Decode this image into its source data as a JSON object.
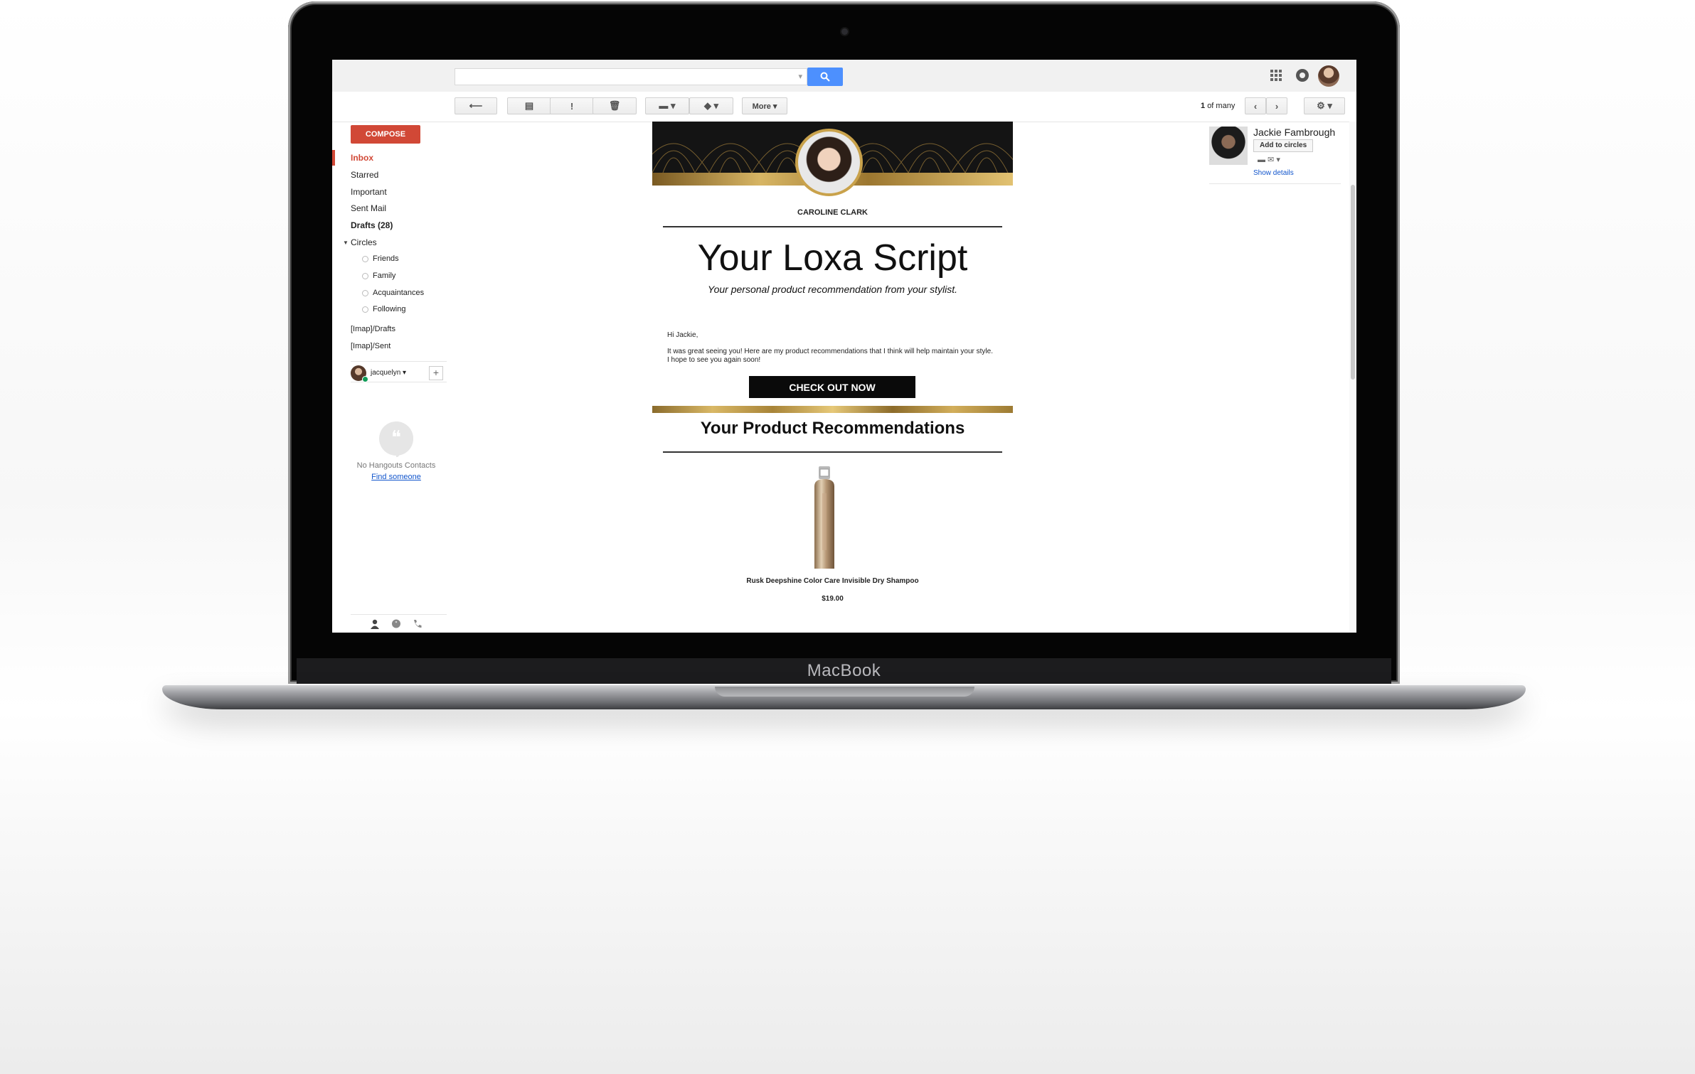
{
  "device": {
    "brand": "MacBook"
  },
  "search": {
    "placeholder": "",
    "caret": "▾"
  },
  "toolbar": {
    "back_glyph": "⟵",
    "archive_glyph": "▤",
    "spam_glyph": "!",
    "delete_glyph": "🗑",
    "folder_glyph": "▬ ▾",
    "label_glyph": "◆ ▾",
    "more_label": "More ▾",
    "pager_count": "1",
    "pager_of": "of many",
    "prev_glyph": "‹",
    "next_glyph": "›",
    "settings_glyph": "⚙ ▾"
  },
  "sidebar": {
    "compose_label": "COMPOSE",
    "items": [
      {
        "label": "Inbox"
      },
      {
        "label": "Starred"
      },
      {
        "label": "Important"
      },
      {
        "label": "Sent Mail"
      },
      {
        "label": "Drafts (28)"
      },
      {
        "label": "Circles"
      }
    ],
    "circles": [
      {
        "label": "Friends"
      },
      {
        "label": "Family"
      },
      {
        "label": "Acquaintances"
      },
      {
        "label": "Following"
      }
    ],
    "labels": [
      {
        "label": "[Imap]/Drafts"
      },
      {
        "label": "[Imap]/Sent"
      }
    ],
    "hangouts_user": "jacquelyn",
    "hangouts_user_caret": "▾",
    "hangouts_add": "+",
    "no_hangouts": "No Hangouts Contacts",
    "find_someone": "Find someone"
  },
  "email": {
    "stylist_name": "CAROLINE CLARK",
    "title": "Your Loxa Script",
    "subtitle": "Your personal product recommendation from your stylist.",
    "greeting": "Hi Jackie,",
    "message": "It was great seeing you! Here are my product recommendations that I think will help maintain your style. I hope to see you again soon!",
    "cta_label": "CHECK OUT NOW",
    "recommendations_title": "Your Product Recommendations",
    "product_name": "Rusk Deepshine Color Care Invisible Dry Shampoo",
    "product_price": "$19.00"
  },
  "contact": {
    "name": "Jackie Fambrough",
    "add_circles": "Add to circles",
    "icons": "▬  ✉  ▾",
    "show_details": "Show details"
  },
  "colors": {
    "compose": "#d14836",
    "search_button": "#4d90fe",
    "gold": "#c9a24b",
    "link": "#1155cc"
  }
}
